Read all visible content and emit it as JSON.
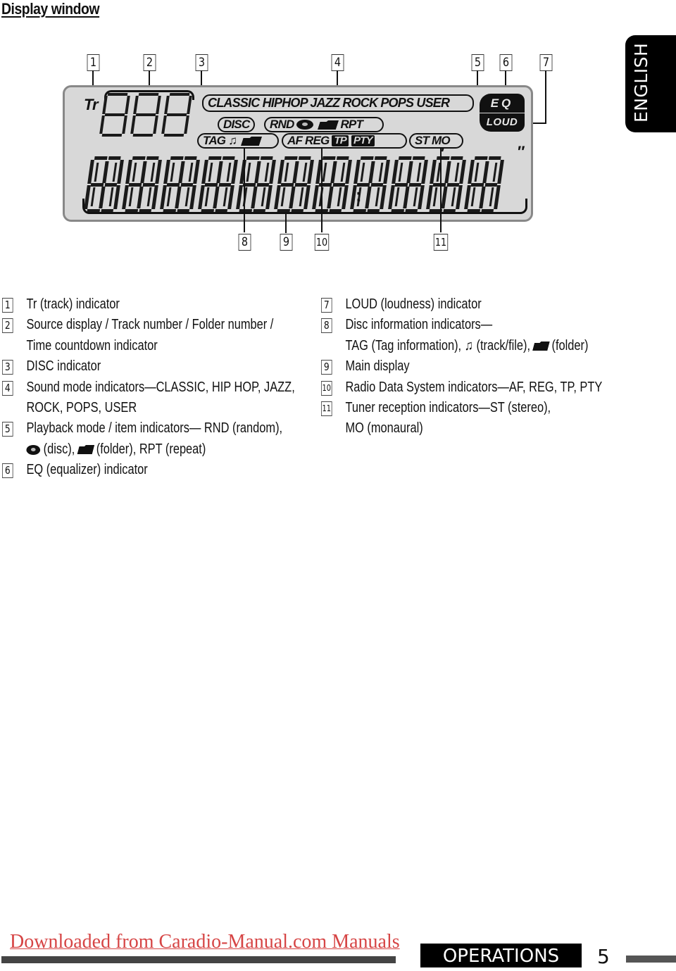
{
  "page": {
    "title": "Display window",
    "language_tab": "ENGLISH"
  },
  "diagram": {
    "callouts": [
      "1",
      "2",
      "3",
      "4",
      "5",
      "6",
      "7",
      "8",
      "9",
      "10",
      "11"
    ],
    "lcd": {
      "tr_label": "Tr",
      "sound_modes": "CLASSIC HIPHOP JAZZ ROCK POPS USER",
      "disc_label": "DISC",
      "rnd_label": "RND",
      "rpt_label": "RPT",
      "tag_label": "TAG",
      "af_reg_label": "AF REG",
      "tp_label": "TP",
      "pty_label": "PTY",
      "st_mo_label": "ST MO",
      "eq_label": "EQ",
      "loud_label": "LOUD",
      "note_glyph": "♫",
      "colon": ":",
      "prime": "′",
      "double_prime": "″",
      "small_digits": 3,
      "main_digits": 11
    }
  },
  "descriptions": {
    "left": [
      {
        "num": "1",
        "lines": [
          "Tr (track) indicator"
        ]
      },
      {
        "num": "2",
        "lines": [
          "Source display / Track number / Folder number /",
          "Time countdown indicator"
        ]
      },
      {
        "num": "3",
        "lines": [
          "DISC indicator"
        ]
      },
      {
        "num": "4",
        "lines": [
          "Sound mode indicators—CLASSIC, HIP HOP, JAZZ,",
          "ROCK, POPS, USER"
        ]
      },
      {
        "num": "5",
        "lines": [
          "Playback mode / item indicators— RND (random),"
        ],
        "line2_disc": "(disc),",
        "line2_folder": "(folder), RPT (repeat)"
      },
      {
        "num": "6",
        "lines": [
          "EQ (equalizer) indicator"
        ]
      }
    ],
    "right": [
      {
        "num": "7",
        "lines": [
          "LOUD (loudness) indicator"
        ]
      },
      {
        "num": "8",
        "lines": [
          "Disc information indicators—"
        ],
        "line2_a": "TAG (Tag information),",
        "line2_b": "(track/file),",
        "line2_c": "(folder)"
      },
      {
        "num": "9",
        "lines": [
          "Main display"
        ]
      },
      {
        "num": "10",
        "lines": [
          "Radio Data System indicators—AF, REG, TP, PTY"
        ]
      },
      {
        "num": "11",
        "lines": [
          "Tuner reception indicators—ST (stereo),",
          "MO (monaural)"
        ]
      }
    ]
  },
  "footer": {
    "download_link": "Downloaded from Caradio-Manual.com Manuals",
    "section": "OPERATIONS",
    "page_number": "5"
  },
  "colors": {
    "lcd_background": "#d8d8d8",
    "link": "#d64545",
    "ink": "#111111"
  }
}
